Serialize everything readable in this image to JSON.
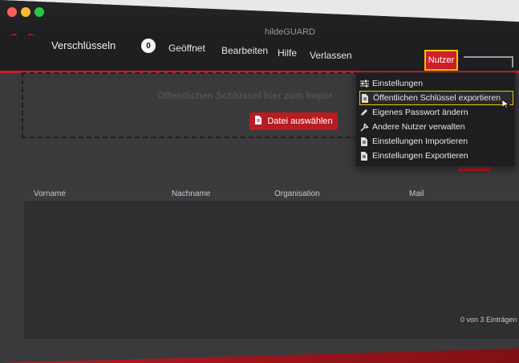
{
  "window": {
    "title": "hildeGUARD"
  },
  "toolbar": {
    "brand": "Verschlüsseln",
    "badge": "0",
    "menu": [
      "Geöffnet",
      "Bearbeiten",
      "Hilfe",
      "Verlassen"
    ],
    "user_button": "Nutzer"
  },
  "dropzone": {
    "text": "Öffentlichen Schlüssel hier zum Impor",
    "button": "Datei auswählen"
  },
  "table": {
    "columns": [
      "Vorname",
      "Nachname",
      "Organisation",
      "Mail"
    ],
    "rows": [],
    "footer": "0 von 3 Einträgen"
  },
  "dropdown": {
    "items": [
      {
        "icon": "sliders-icon",
        "label": "Einstellungen"
      },
      {
        "icon": "document-icon",
        "label": "Öffentlichen Schlüssel exportieren",
        "active": true
      },
      {
        "icon": "pencil-icon",
        "label": "Eigenes Passwort ändern"
      },
      {
        "icon": "tools-icon",
        "label": "Andere Nutzer verwalten"
      },
      {
        "icon": "document-icon",
        "label": "Einstellungen Importieren"
      },
      {
        "icon": "document-icon",
        "label": "Einstellungen Exportieren"
      }
    ]
  },
  "colors": {
    "accent": "#c61f26",
    "highlight": "#f2c200",
    "panel": "#2f2f31"
  }
}
